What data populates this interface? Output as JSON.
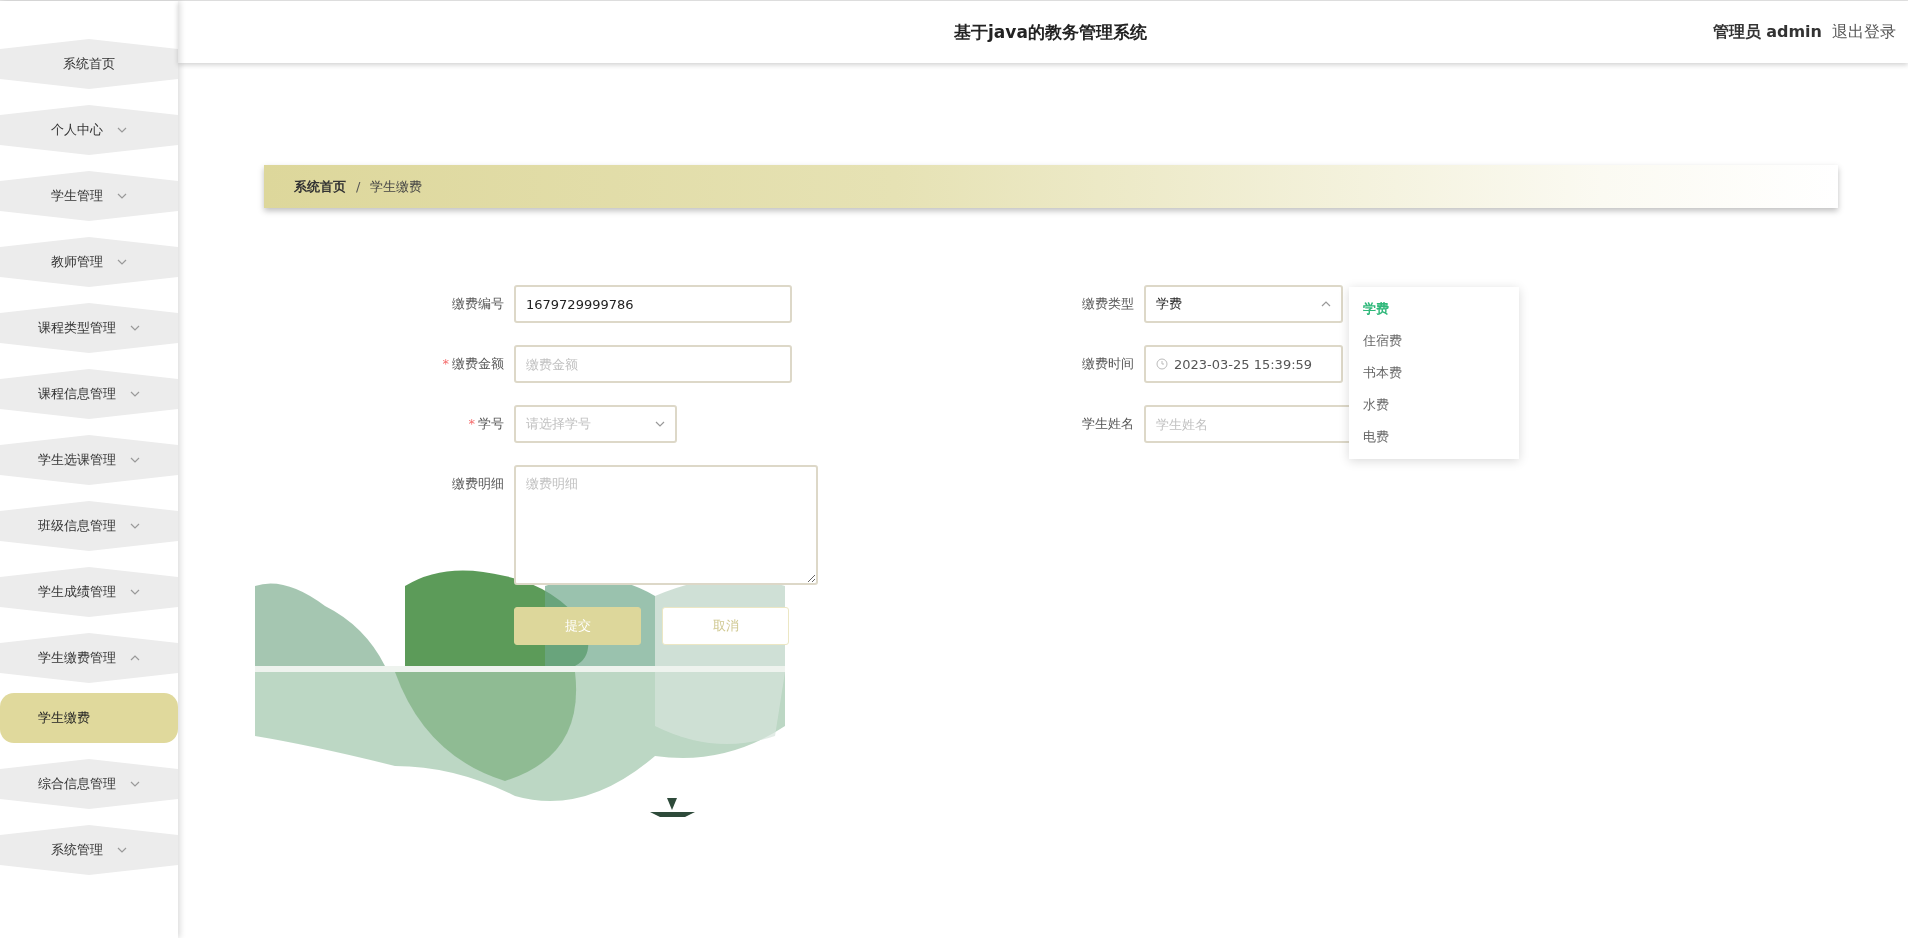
{
  "header": {
    "title": "基于java的教务管理系统",
    "user": "管理员 admin",
    "logout": "退出登录"
  },
  "sidebar": {
    "items": [
      {
        "label": "系统首页",
        "kind": "link"
      },
      {
        "label": "个人中心",
        "kind": "menu",
        "expanded": false
      },
      {
        "label": "学生管理",
        "kind": "menu",
        "expanded": false
      },
      {
        "label": "教师管理",
        "kind": "menu",
        "expanded": false
      },
      {
        "label": "课程类型管理",
        "kind": "menu",
        "expanded": false
      },
      {
        "label": "课程信息管理",
        "kind": "menu",
        "expanded": false
      },
      {
        "label": "学生选课管理",
        "kind": "menu",
        "expanded": false
      },
      {
        "label": "班级信息管理",
        "kind": "menu",
        "expanded": false
      },
      {
        "label": "学生成绩管理",
        "kind": "menu",
        "expanded": false
      },
      {
        "label": "学生缴费管理",
        "kind": "menu",
        "expanded": true,
        "children": [
          {
            "label": "学生缴费",
            "selected": true
          }
        ]
      },
      {
        "label": "综合信息管理",
        "kind": "menu",
        "expanded": false
      },
      {
        "label": "系统管理",
        "kind": "menu",
        "expanded": false
      }
    ]
  },
  "breadcrumb": {
    "separator": "/",
    "items": [
      "系统首页",
      "学生缴费"
    ]
  },
  "form": {
    "required_mark": "*",
    "left": [
      {
        "label": "缴费编号",
        "kind": "input",
        "value": "1679729999786",
        "required": false
      },
      {
        "label": "缴费金额",
        "kind": "input",
        "placeholder": "缴费金额",
        "required": true
      },
      {
        "label": "学号",
        "kind": "select",
        "placeholder": "请选择学号",
        "required": true
      },
      {
        "label": "缴费明细",
        "kind": "textarea",
        "placeholder": "缴费明细",
        "required": false
      }
    ],
    "right": [
      {
        "label": "缴费类型",
        "kind": "select",
        "value": "学费",
        "required": false,
        "open": true,
        "options": [
          {
            "label": "学费",
            "selected": true
          },
          {
            "label": "住宿费",
            "selected": false
          },
          {
            "label": "书本费",
            "selected": false
          },
          {
            "label": "水费",
            "selected": false
          },
          {
            "label": "电费",
            "selected": false
          }
        ]
      },
      {
        "label": "缴费时间",
        "kind": "date",
        "value": "2023-03-25 15:39:59",
        "required": false
      },
      {
        "label": "学生姓名",
        "kind": "input",
        "placeholder": "学生姓名",
        "required": false
      }
    ],
    "buttons": [
      {
        "label": "提交",
        "kind": "primary"
      },
      {
        "label": "取消",
        "kind": "secondary"
      }
    ]
  }
}
